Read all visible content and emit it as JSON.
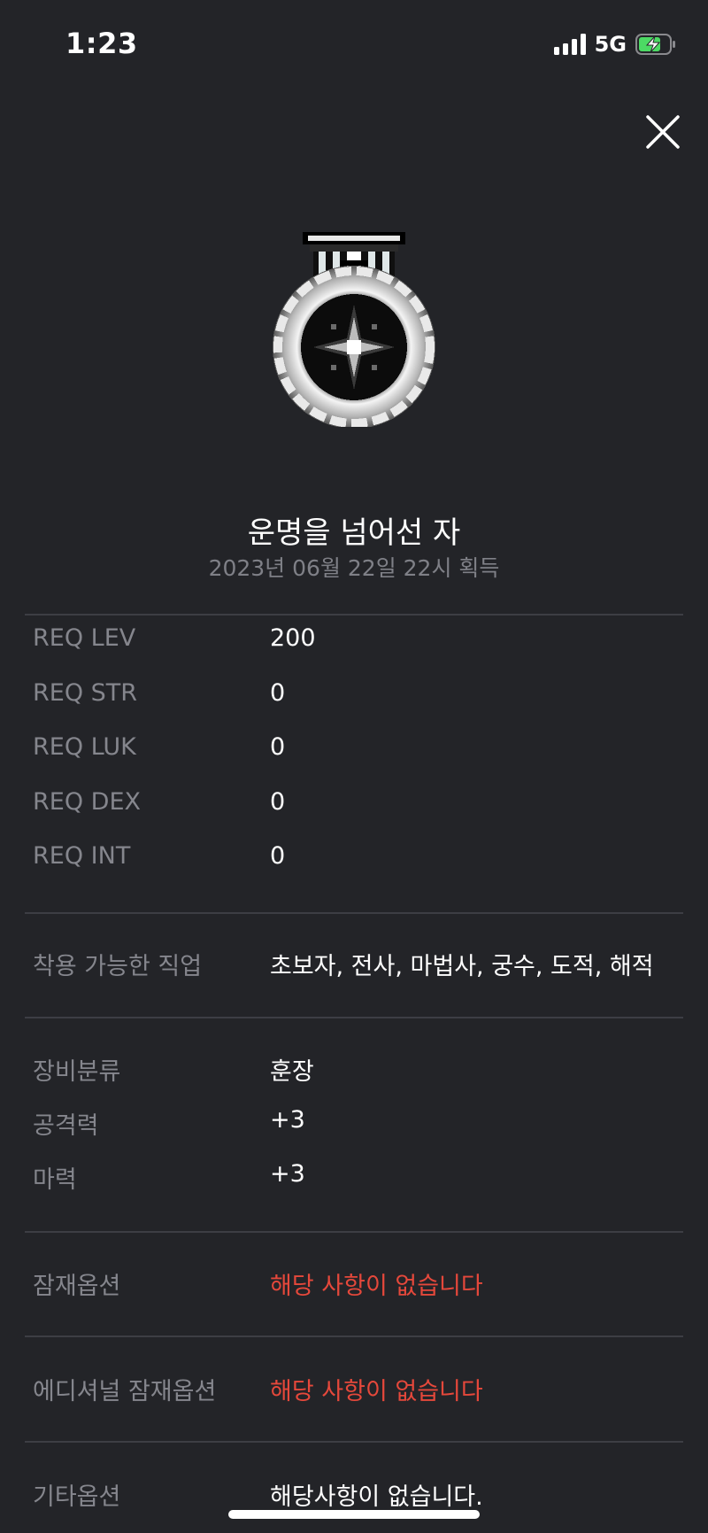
{
  "status_bar": {
    "time": "1:23",
    "network": "5G",
    "battery_color": "#4cd964"
  },
  "item": {
    "name": "운명을 넘어선 자",
    "acquired": "2023년 06월 22일 22시 획득"
  },
  "requirements": [
    {
      "label": "REQ LEV",
      "value": "200"
    },
    {
      "label": "REQ STR",
      "value": "0"
    },
    {
      "label": "REQ LUK",
      "value": "0"
    },
    {
      "label": "REQ DEX",
      "value": "0"
    },
    {
      "label": "REQ INT",
      "value": "0"
    }
  ],
  "jobs": {
    "label": "착용 가능한 직업",
    "value": "초보자, 전사, 마법사, 궁수, 도적, 해적"
  },
  "equipment": [
    {
      "label": "장비분류",
      "value": "훈장"
    },
    {
      "label": "공격력",
      "value": "+3"
    },
    {
      "label": "마력",
      "value": "+3"
    }
  ],
  "potential": {
    "label": "잠재옵션",
    "value": "해당 사항이 없습니다"
  },
  "additional_potential": {
    "label": "에디셔널 잠재옵션",
    "value": "해당 사항이 없습니다"
  },
  "other_options": {
    "label": "기타옵션",
    "value": "해당사항이 없습니다."
  },
  "colors": {
    "background": "#232428",
    "label": "#85868d",
    "value": "#ffffff",
    "warning": "#e5483b",
    "divider": "#3d3e44"
  },
  "icons": {
    "close": "close-icon",
    "item": "medal-icon"
  }
}
